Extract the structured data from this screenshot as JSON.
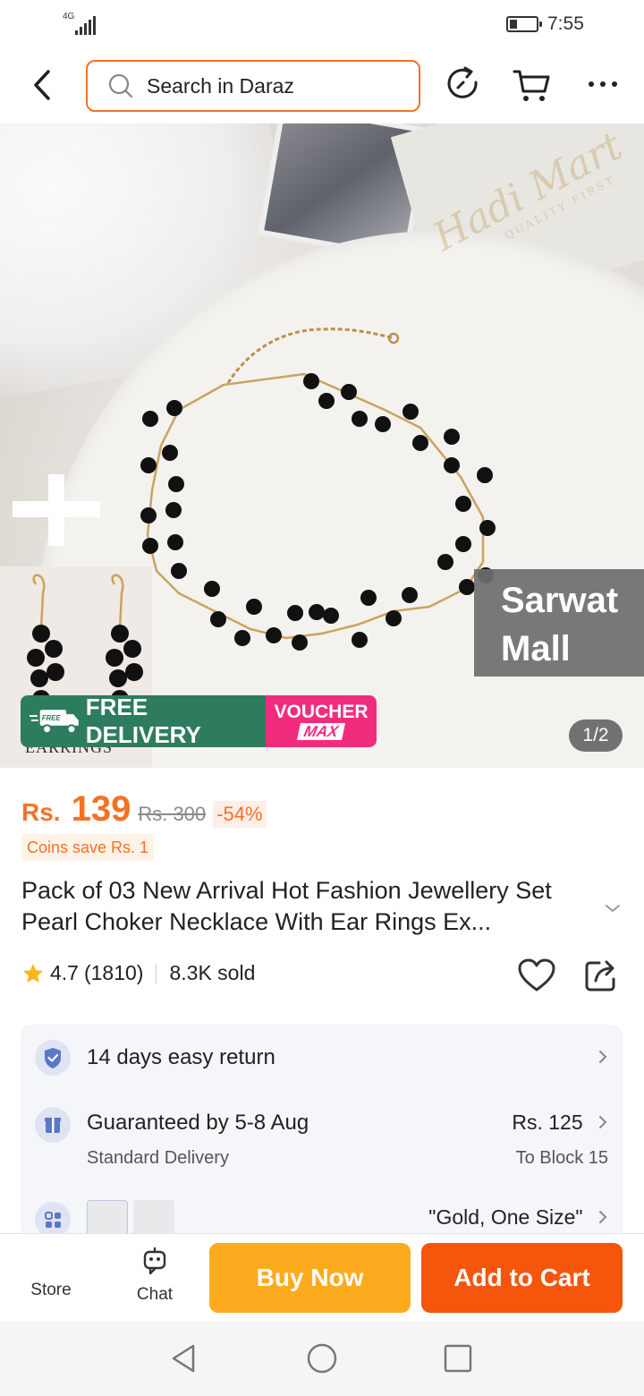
{
  "status_bar": {
    "network": "4G",
    "time": "7:55"
  },
  "header": {
    "search_placeholder": "Search in Daraz"
  },
  "hero": {
    "watermark_brand": "Hadi Mart",
    "watermark_tagline": "QUALITY FIRST",
    "earrings_text": "EARRINGS",
    "seller_tag_line1": "Sarwat",
    "seller_tag_line2": "Mall",
    "promo_free_badge": "FREE",
    "promo_free_delivery": "FREE DELIVERY",
    "promo_voucher": "VOUCHER",
    "promo_max": "MAX",
    "pager": "1/2"
  },
  "product": {
    "currency": "Rs.",
    "price": "139",
    "original_price": "Rs. 300",
    "discount": "-54%",
    "coins": "Coins save Rs. 1",
    "title": "Pack of 03 New Arrival Hot Fashion Jewellery Set Pearl Choker Necklace With Ear Rings Ex...",
    "rating": "4.7",
    "reviews": "(1810)",
    "sold": "8.3K sold"
  },
  "info": {
    "return_label": "14 days easy return",
    "delivery_label": "Guaranteed by 5-8 Aug",
    "delivery_sub": "Standard Delivery",
    "delivery_price": "Rs. 125",
    "delivery_location": "To Block 15",
    "variant_value": "\"Gold, One Size\""
  },
  "bottom_bar": {
    "store_label": "Store",
    "chat_label": "Chat",
    "buy_now": "Buy Now",
    "add_to_cart": "Add to Cart"
  },
  "colors": {
    "brand_orange": "#f57224",
    "buy_now": "#fcab1f",
    "add_to_cart": "#f6550c",
    "free_delivery_green": "#2e7c5e",
    "voucher_pink": "#f22c7c"
  }
}
